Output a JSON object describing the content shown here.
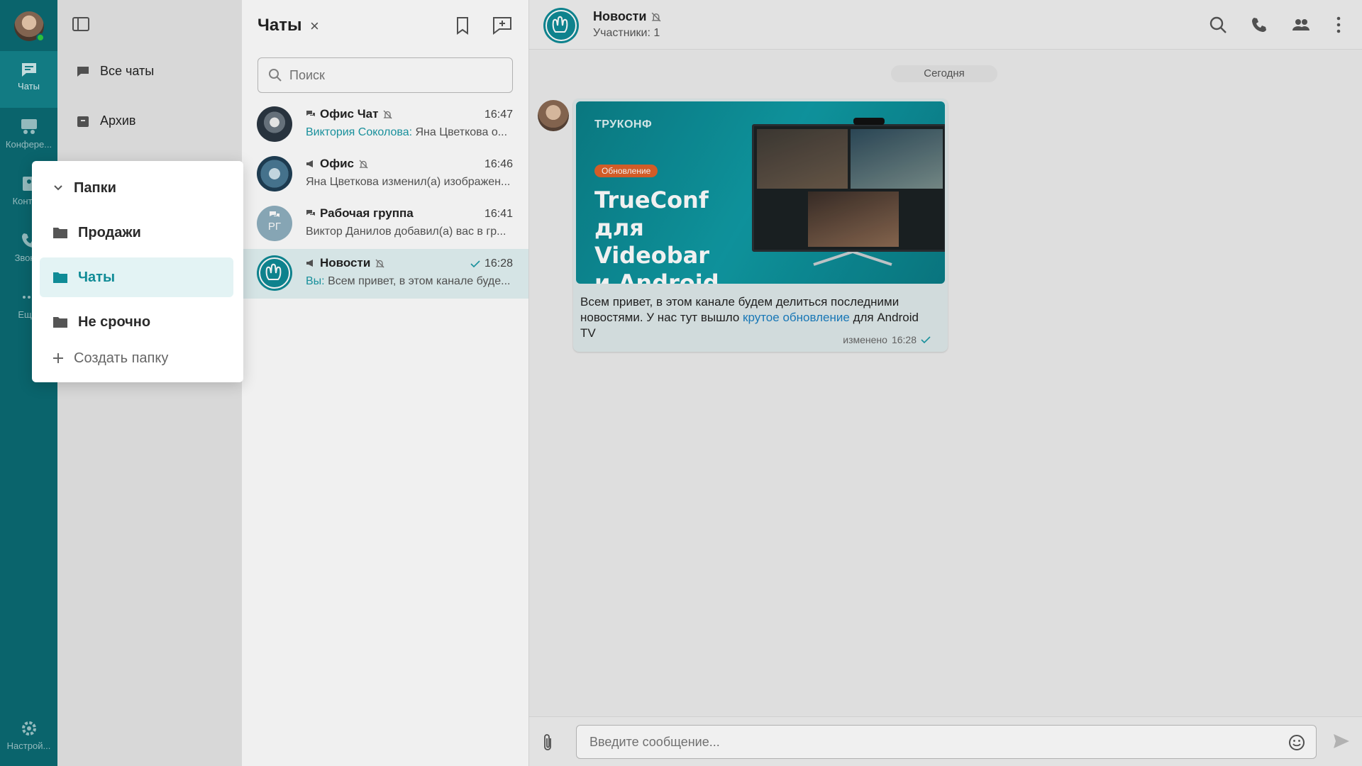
{
  "rail": {
    "items": [
      {
        "label": "Чаты",
        "icon": "chat-icon"
      },
      {
        "label": "Конфере...",
        "icon": "conference-icon"
      },
      {
        "label": "Конта...",
        "icon": "contacts-icon"
      },
      {
        "label": "Звон...",
        "icon": "phone-icon"
      },
      {
        "label": "Ещ...",
        "icon": "more-icon"
      }
    ],
    "settings_label": "Настрой..."
  },
  "folders": {
    "all_chats": "Все чаты",
    "archive": "Архив"
  },
  "menu": {
    "header": "Папки",
    "items": [
      "Продажи",
      "Чаты",
      "Не срочно"
    ],
    "create": "Создать папку"
  },
  "chatlist": {
    "title": "Чаты",
    "close": "×",
    "search_placeholder": "Поиск",
    "chats": [
      {
        "name": "Офис Чат",
        "time": "16:47",
        "sender": "Виктория Соколова:",
        "preview": " Яна Цветкова о...",
        "muted": true,
        "type": "group"
      },
      {
        "name": "Офис",
        "time": "16:46",
        "sender": "",
        "preview": "Яна Цветкова изменил(а) изображен...",
        "muted": true,
        "type": "channel"
      },
      {
        "name": "Рабочая группа",
        "time": "16:41",
        "sender": "",
        "preview": "Виктор Данилов добавил(а) вас в гр...",
        "muted": false,
        "type": "group",
        "initials": "РГ"
      },
      {
        "name": "Новости",
        "time": "16:28",
        "sender": "Вы:",
        "preview": " Всем привет, в этом канале буде...",
        "muted": true,
        "type": "channel",
        "read": true
      }
    ]
  },
  "chat": {
    "title": "Новости",
    "subtitle": "Участники: 1",
    "date_chip": "Сегодня",
    "banner": {
      "brand": "ТРУКОНФ",
      "badge": "Обновление",
      "headline_1": "TrueConf",
      "headline_2": "для Videobar",
      "headline_3": "и Android TV"
    },
    "message_part1": "Всем привет, в этом канале будем делиться последними новостями. У нас тут вышло ",
    "message_link": "крутое обновление",
    "message_part2": " для Android TV",
    "edited": "изменено",
    "time": "16:28",
    "composer_placeholder": "Введите сообщение..."
  },
  "colors": {
    "accent": "#0f8b96",
    "rail": "#0b6b73",
    "link": "#1a7fc2"
  }
}
